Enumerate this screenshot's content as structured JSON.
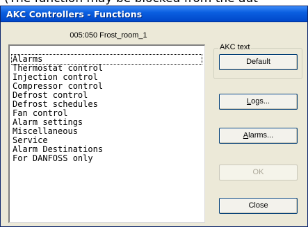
{
  "background_caption": "(The function may be blocked from the aut",
  "window": {
    "title": "AKC Controllers - Functions",
    "controller_label": "005:050  Frost_room_1"
  },
  "functions_list": {
    "items": [
      "Alarms",
      "Thermostat control",
      "Injection control",
      "Compressor control",
      "Defrost control",
      "Defrost schedules",
      "Fan control",
      "Alarm settings",
      "Miscellaneous",
      "Service",
      "Alarm Destinations",
      "For DANFOSS only"
    ],
    "focused_index": 0
  },
  "akc_text_group": {
    "legend": "AKC text",
    "default_button": "Default"
  },
  "buttons": {
    "logs_label": "Logs...",
    "logs_mnemonic": "L",
    "logs_rest": "ogs...",
    "alarms_label": "Alarms...",
    "alarms_mnemonic": "A",
    "alarms_rest": "larms...",
    "ok_label": "OK",
    "ok_enabled": false,
    "close_label": "Close"
  },
  "colors": {
    "titlebar": "#0a5fe0",
    "dialog_bg": "#ece9d8",
    "button_border": "#003c74",
    "disabled_text": "#aca899"
  }
}
